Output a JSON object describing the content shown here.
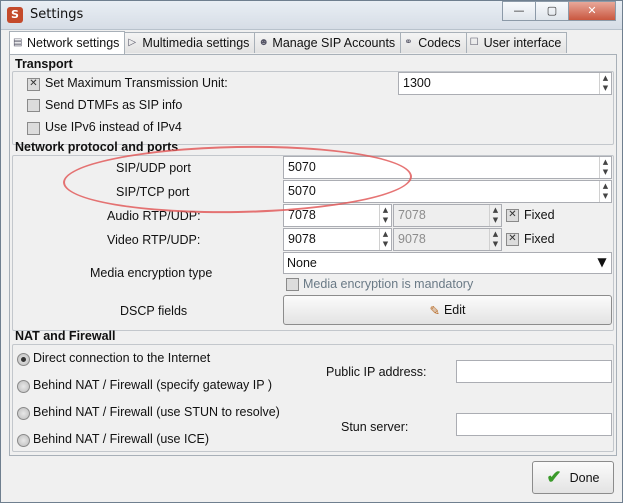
{
  "window": {
    "title": "Settings"
  },
  "tabs": [
    {
      "label": "Network settings",
      "icon": "network-icon"
    },
    {
      "label": "Multimedia settings",
      "icon": "play-icon"
    },
    {
      "label": "Manage SIP Accounts",
      "icon": "accounts-icon"
    },
    {
      "label": "Codecs",
      "icon": "codec-icon"
    },
    {
      "label": "User interface",
      "icon": "ui-icon"
    }
  ],
  "transport": {
    "title": "Transport",
    "mtu_label": "Set Maximum Transmission Unit:",
    "mtu_value": "1300",
    "dtmf_label": "Send DTMFs as SIP info",
    "ipv6_label": "Use IPv6 instead of IPv4"
  },
  "ports": {
    "title": "Network protocol and ports",
    "sip_udp_label": "SIP/UDP port",
    "sip_udp_value": "5070",
    "sip_tcp_label": "SIP/TCP port",
    "sip_tcp_value": "5070",
    "audio_label": "Audio RTP/UDP:",
    "audio_value": "7078",
    "audio_value2": "7078",
    "video_label": "Video RTP/UDP:",
    "video_value": "9078",
    "video_value2": "9078",
    "fixed_label": "Fixed",
    "encryption_label": "Media encryption type",
    "encryption_value": "None",
    "mandatory_label": "Media encryption is mandatory",
    "dscp_label": "DSCP fields",
    "edit_label": "Edit"
  },
  "nat": {
    "title": "NAT and Firewall",
    "options": [
      "Direct connection to the Internet",
      "Behind NAT / Firewall (specify gateway IP )",
      "Behind NAT / Firewall (use STUN to resolve)",
      "Behind NAT / Firewall (use ICE)"
    ],
    "public_ip_label": "Public IP address:",
    "stun_label": "Stun server:"
  },
  "footer": {
    "done_label": "Done"
  },
  "colors": {
    "annotation": "#e25c5c"
  }
}
